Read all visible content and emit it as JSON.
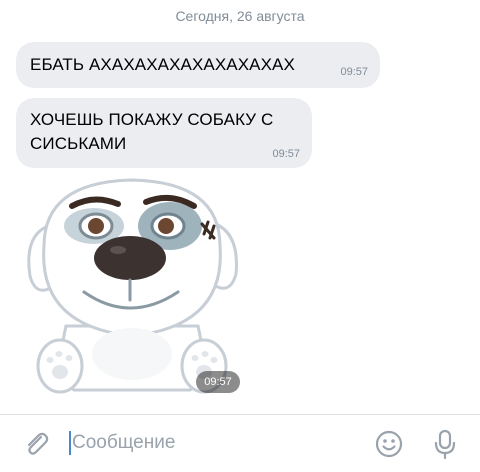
{
  "chat": {
    "date_divider": "Сегодня, 26 августа",
    "messages": [
      {
        "text": "ЕБАТЬ АХАХАХАХАХАХАХАХАХ",
        "time": "09:57"
      },
      {
        "text": "ХОЧЕШЬ ПОКАЖУ СОБАКУ С СИСЬКАМИ",
        "time": "09:57"
      }
    ],
    "sticker": {
      "icon": "dog-sticker-icon",
      "time": "09:57"
    }
  },
  "composer": {
    "placeholder": "Сообщение",
    "value": "",
    "icons": [
      "paperclip-icon",
      "smile-icon",
      "microphone-icon"
    ]
  },
  "colors": {
    "bubble_bg": "#ebedf0",
    "secondary_text": "#818c99",
    "icon": "#99a2ad",
    "accent": "#4986cc"
  }
}
